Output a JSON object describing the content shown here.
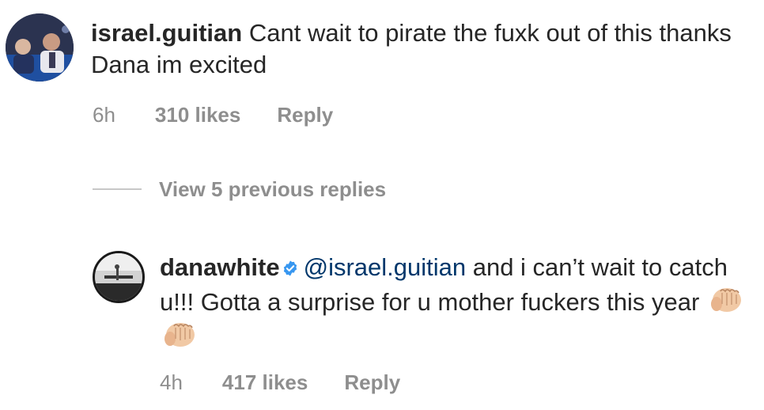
{
  "comment": {
    "username": "israel.guitian",
    "text": "Cant wait to pirate the fuxk out of this thanks Dana im excited",
    "time": "6h",
    "likes": "310 likes",
    "reply_label": "Reply"
  },
  "view_replies": {
    "label": "View 5 previous replies"
  },
  "reply": {
    "username": "danawhite",
    "verified": true,
    "mention": "@israel.guitian",
    "text": " and i can’t wait to catch u!!! Gotta a surprise for u mother fuckers this year",
    "emoji": [
      "oncoming-fist-emoji",
      "oncoming-fist-emoji"
    ],
    "time": "4h",
    "likes": "417 likes",
    "reply_label": "Reply"
  },
  "colors": {
    "text": "#262626",
    "meta": "#8e8e8e",
    "mention": "#00376b",
    "verified": "#3897f0"
  }
}
